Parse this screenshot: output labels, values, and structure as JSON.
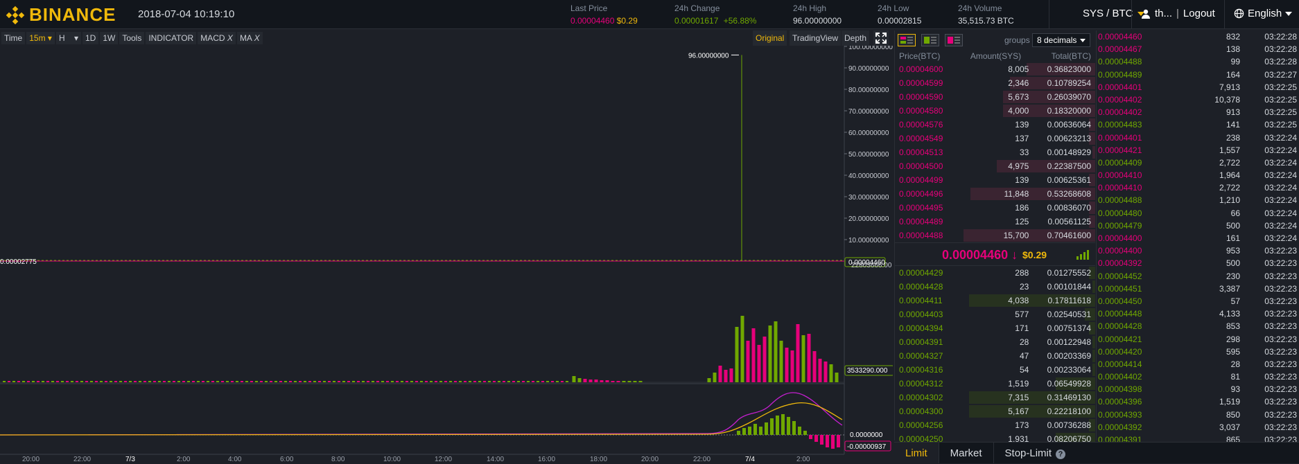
{
  "header": {
    "brand": "BINANCE",
    "datetime": "2018-07-04 10:19:10",
    "last_price_label": "Last Price",
    "last_price": "0.00004460",
    "last_price_usd": "$0.29",
    "change_label": "24h Change",
    "change_value": "0.00001617",
    "change_pct": "+56.88%",
    "high_label": "24h High",
    "high_value": "96.00000000",
    "low_label": "24h Low",
    "low_value": "0.00002815",
    "volume_label": "24h Volume",
    "volume_value": "35,515.73 BTC",
    "pair": "SYS / BTC",
    "user": "th...",
    "logout": "Logout",
    "language": "English"
  },
  "toolbar": {
    "items": [
      "Time",
      "15m",
      "H",
      "1D",
      "1W",
      "Tools",
      "INDICATOR"
    ],
    "macd": "MACD",
    "ma": "MA",
    "close_x": "X",
    "original": "Original",
    "tradingview": "TradingView",
    "depth": "Depth"
  },
  "chart_data": {
    "type": "candlestick",
    "price_axis": [
      "100.00000000",
      "90.00000000",
      "80.00000000",
      "70.00000000",
      "60.00000000",
      "50.00000000",
      "40.00000000",
      "30.00000000",
      "20.00000000",
      "10.00000000"
    ],
    "time_axis": [
      "20:00",
      "22:00",
      "7/3",
      "2:00",
      "4:00",
      "6:00",
      "8:00",
      "10:00",
      "12:00",
      "14:00",
      "16:00",
      "18:00",
      "20:00",
      "22:00",
      "7/4",
      "2:00"
    ],
    "spike_label": "96.00000000",
    "left_label": "0.00002775",
    "current_price_tag": "0.00004460",
    "volume_max_label": "22803666.00",
    "volume_tag": "3533290.000",
    "macd_zero_tag": "0.0000000",
    "macd_tag": "-0.00000937"
  },
  "orderbook": {
    "groups_label": "groups",
    "groups_value": "8 decimals",
    "col_price": "Price(BTC)",
    "col_amount": "Amount(SYS)",
    "col_total": "Total(BTC)",
    "asks": [
      {
        "p": "0.00004600",
        "a": "8,005",
        "t": "0.36823000",
        "w": 0.52
      },
      {
        "p": "0.00004599",
        "a": "2,346",
        "t": "0.10789254",
        "w": 0.65
      },
      {
        "p": "0.00004590",
        "a": "5,673",
        "t": "0.26039070",
        "w": 0.7
      },
      {
        "p": "0.00004580",
        "a": "4,000",
        "t": "0.18320000",
        "w": 0.7
      },
      {
        "p": "0.00004576",
        "a": "139",
        "t": "0.00636064",
        "w": 0.05
      },
      {
        "p": "0.00004549",
        "a": "137",
        "t": "0.00623213",
        "w": 0.05
      },
      {
        "p": "0.00004513",
        "a": "33",
        "t": "0.00148929",
        "w": 0.02
      },
      {
        "p": "0.00004500",
        "a": "4,975",
        "t": "0.22387500",
        "w": 0.75
      },
      {
        "p": "0.00004499",
        "a": "139",
        "t": "0.00625361",
        "w": 0.05
      },
      {
        "p": "0.00004496",
        "a": "11,848",
        "t": "0.53268608",
        "w": 0.95
      },
      {
        "p": "0.00004495",
        "a": "186",
        "t": "0.00836070",
        "w": 0.05
      },
      {
        "p": "0.00004489",
        "a": "125",
        "t": "0.00561125",
        "w": 0.05
      },
      {
        "p": "0.00004488",
        "a": "15,700",
        "t": "0.70461600",
        "w": 1.0
      }
    ],
    "last_price": "0.00004460",
    "last_arrow": "↓",
    "last_usd": "$0.29",
    "bids": [
      {
        "p": "0.00004429",
        "a": "288",
        "t": "0.01275552",
        "w": 0.05
      },
      {
        "p": "0.00004428",
        "a": "23",
        "t": "0.00101844",
        "w": 0.02
      },
      {
        "p": "0.00004411",
        "a": "4,038",
        "t": "0.17811618",
        "w": 0.96
      },
      {
        "p": "0.00004403",
        "a": "577",
        "t": "0.02540531",
        "w": 0.08
      },
      {
        "p": "0.00004394",
        "a": "171",
        "t": "0.00751374",
        "w": 0.05
      },
      {
        "p": "0.00004391",
        "a": "28",
        "t": "0.00122948",
        "w": 0.02
      },
      {
        "p": "0.00004327",
        "a": "47",
        "t": "0.00203369",
        "w": 0.02
      },
      {
        "p": "0.00004316",
        "a": "54",
        "t": "0.00233064",
        "w": 0.02
      },
      {
        "p": "0.00004312",
        "a": "1,519",
        "t": "0.06549928",
        "w": 0.3
      },
      {
        "p": "0.00004302",
        "a": "7,315",
        "t": "0.31469130",
        "w": 0.96
      },
      {
        "p": "0.00004300",
        "a": "5,167",
        "t": "0.22218100",
        "w": 0.96
      },
      {
        "p": "0.00004256",
        "a": "173",
        "t": "0.00736288",
        "w": 0.05
      },
      {
        "p": "0.00004250",
        "a": "1,931",
        "t": "0.08206750",
        "w": 0.3
      }
    ]
  },
  "trades": [
    {
      "p": "0.00004460",
      "c": "r",
      "a": "832",
      "t": "03:22:28"
    },
    {
      "p": "0.00004467",
      "c": "r",
      "a": "138",
      "t": "03:22:28"
    },
    {
      "p": "0.00004488",
      "c": "g",
      "a": "99",
      "t": "03:22:28"
    },
    {
      "p": "0.00004489",
      "c": "g",
      "a": "164",
      "t": "03:22:27"
    },
    {
      "p": "0.00004401",
      "c": "r",
      "a": "7,913",
      "t": "03:22:25"
    },
    {
      "p": "0.00004402",
      "c": "r",
      "a": "10,378",
      "t": "03:22:25"
    },
    {
      "p": "0.00004402",
      "c": "r",
      "a": "913",
      "t": "03:22:25"
    },
    {
      "p": "0.00004483",
      "c": "g",
      "a": "141",
      "t": "03:22:25"
    },
    {
      "p": "0.00004401",
      "c": "r",
      "a": "238",
      "t": "03:22:24"
    },
    {
      "p": "0.00004421",
      "c": "r",
      "a": "1,557",
      "t": "03:22:24"
    },
    {
      "p": "0.00004409",
      "c": "g",
      "a": "2,722",
      "t": "03:22:24"
    },
    {
      "p": "0.00004410",
      "c": "r",
      "a": "1,964",
      "t": "03:22:24"
    },
    {
      "p": "0.00004410",
      "c": "r",
      "a": "2,722",
      "t": "03:22:24"
    },
    {
      "p": "0.00004488",
      "c": "g",
      "a": "1,210",
      "t": "03:22:24"
    },
    {
      "p": "0.00004480",
      "c": "g",
      "a": "66",
      "t": "03:22:24"
    },
    {
      "p": "0.00004479",
      "c": "g",
      "a": "500",
      "t": "03:22:24"
    },
    {
      "p": "0.00004400",
      "c": "r",
      "a": "161",
      "t": "03:22:24"
    },
    {
      "p": "0.00004400",
      "c": "r",
      "a": "953",
      "t": "03:22:23"
    },
    {
      "p": "0.00004392",
      "c": "r",
      "a": "500",
      "t": "03:22:23"
    },
    {
      "p": "0.00004452",
      "c": "g",
      "a": "230",
      "t": "03:22:23"
    },
    {
      "p": "0.00004451",
      "c": "g",
      "a": "3,387",
      "t": "03:22:23"
    },
    {
      "p": "0.00004450",
      "c": "g",
      "a": "57",
      "t": "03:22:23"
    },
    {
      "p": "0.00004448",
      "c": "g",
      "a": "4,133",
      "t": "03:22:23"
    },
    {
      "p": "0.00004428",
      "c": "g",
      "a": "853",
      "t": "03:22:23"
    },
    {
      "p": "0.00004421",
      "c": "g",
      "a": "298",
      "t": "03:22:23"
    },
    {
      "p": "0.00004420",
      "c": "g",
      "a": "595",
      "t": "03:22:23"
    },
    {
      "p": "0.00004414",
      "c": "g",
      "a": "28",
      "t": "03:22:23"
    },
    {
      "p": "0.00004402",
      "c": "g",
      "a": "81",
      "t": "03:22:23"
    },
    {
      "p": "0.00004398",
      "c": "g",
      "a": "93",
      "t": "03:22:23"
    },
    {
      "p": "0.00004396",
      "c": "g",
      "a": "1,519",
      "t": "03:22:23"
    },
    {
      "p": "0.00004393",
      "c": "g",
      "a": "850",
      "t": "03:22:23"
    },
    {
      "p": "0.00004392",
      "c": "g",
      "a": "3,037",
      "t": "03:22:23"
    },
    {
      "p": "0.00004391",
      "c": "g",
      "a": "865",
      "t": "03:22:23"
    }
  ],
  "bottom_tabs": {
    "limit": "Limit",
    "market": "Market",
    "stop_limit": "Stop-Limit",
    "help": "?"
  },
  "colors": {
    "accent": "#f0b90b",
    "sell": "#e6007a",
    "buy": "#70a800",
    "bg": "#1d2027",
    "panel": "#12161c"
  }
}
